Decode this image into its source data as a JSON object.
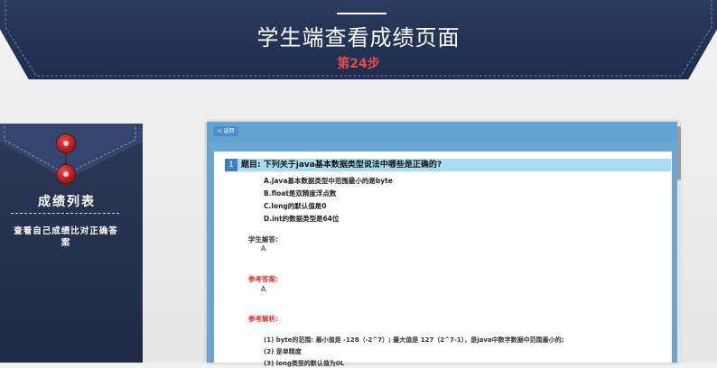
{
  "header": {
    "title": "学生端查看成绩页面",
    "step": "第24步"
  },
  "sidebar": {
    "title": "成绩列表",
    "description": "查看自己成绩比对正确答案"
  },
  "window": {
    "back_label": "< 返回"
  },
  "question": {
    "number": "1",
    "text": "题目: 下列关于java基本数据类型说法中哪些是正确的?",
    "options": [
      "A.java基本数据类型中范围最小的是byte",
      "B.float是双精度浮点数",
      "C.long的默认值是0",
      "D.int的数据类型是64位"
    ],
    "student_answer_label": "学生解答:",
    "student_answer": "A",
    "reference_answer_label": "参考答案:",
    "reference_answer": "A",
    "analysis_label": "参考解析:",
    "analysis_lines": [
      "(1) byte的范围: 最小值是 -128（-2^7）; 最大值是 127（2^7-1），是java中数字数据中范围最小的;",
      "(2) 是单精度",
      "(3) long类型的默认值为0L"
    ]
  },
  "colors": {
    "banner": "#2b3b5e",
    "step": "#e84a4a",
    "window_header": "#62a3d3",
    "question_bar": "#a9dcf2",
    "answer_label_red": "#e03030"
  }
}
